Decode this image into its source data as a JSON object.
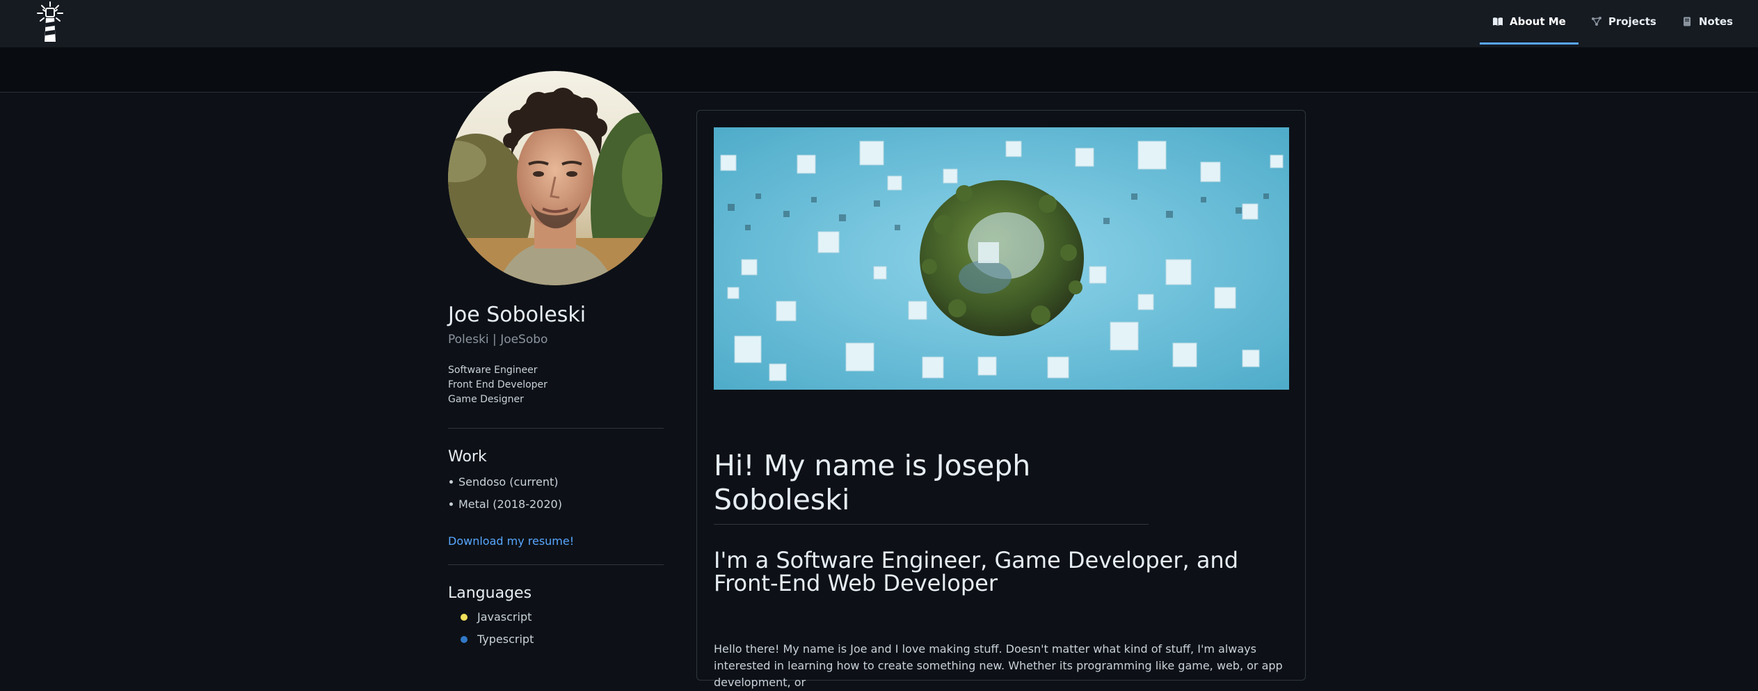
{
  "header": {
    "logo_icon": "lighthouse-icon",
    "nav": [
      {
        "label": "About Me",
        "icon": "book-icon",
        "active": true
      },
      {
        "label": "Projects",
        "icon": "graph-icon",
        "active": false
      },
      {
        "label": "Notes",
        "icon": "notebook-icon",
        "active": false
      }
    ]
  },
  "profile": {
    "name": "Joe Soboleski",
    "nickname": "Poleski | JoeSobo",
    "roles": [
      "Software Engineer",
      "Front End Developer",
      "Game Designer"
    ]
  },
  "work": {
    "title": "Work",
    "items": [
      "Sendoso (current)",
      "Metal (2018-2020)"
    ],
    "resume_link": "Download my resume!"
  },
  "languages": {
    "title": "Languages",
    "items": [
      {
        "name": "Javascript",
        "color": "#f1e05a"
      },
      {
        "name": "Typescript",
        "color": "#3178c6"
      }
    ]
  },
  "main": {
    "heading": "Hi! My name is Joseph Soboleski",
    "subheading": "I'm a Software Engineer, Game Developer, and Front-End Web Developer",
    "paragraph": "Hello there! My name is Joe and I love making stuff. Doesn't matter what kind of stuff, I'm always interested in learning how to create something new. Whether its programming like game, web, or app development, or"
  },
  "colors": {
    "accent": "#58a6ff",
    "background": "#0d1117",
    "header": "#161b22"
  }
}
